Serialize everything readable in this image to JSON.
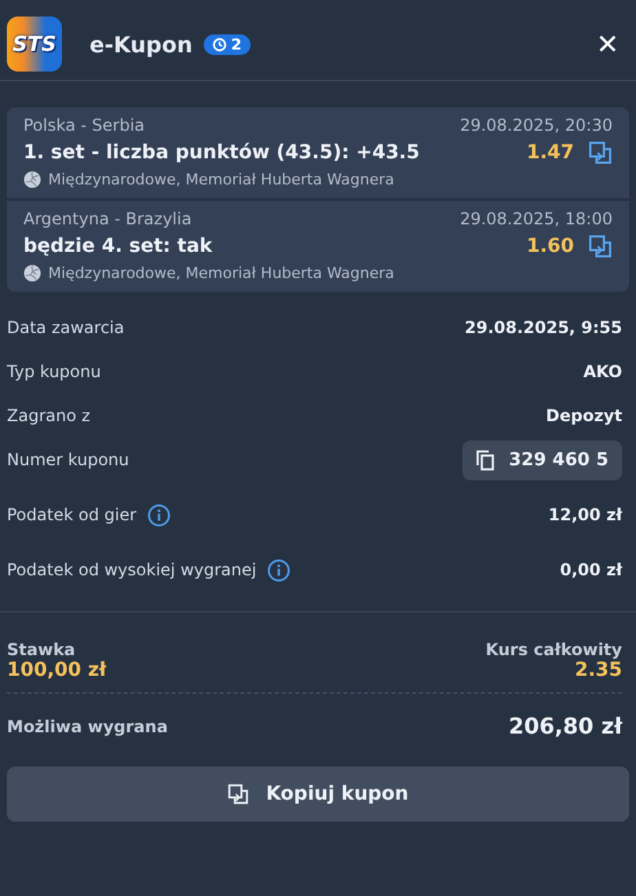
{
  "header": {
    "logo": "STS",
    "title": "e-Kupon",
    "badge": "2",
    "close": "✕"
  },
  "bets": [
    {
      "match": "Polska - Serbia",
      "datetime": "29.08.2025, 20:30",
      "selection": "1. set - liczba punktów (43.5): +43.5",
      "odds": "1.47",
      "league": "Międzynarodowe, Memoriał Huberta Wagnera"
    },
    {
      "match": "Argentyna - Brazylia",
      "datetime": "29.08.2025, 18:00",
      "selection": "będzie 4. set: tak",
      "odds": "1.60",
      "league": "Międzynarodowe, Memoriał Huberta Wagnera"
    }
  ],
  "details": [
    {
      "kind": "text",
      "label": "Data zawarcia",
      "value": "29.08.2025, 9:55",
      "info": false
    },
    {
      "kind": "text",
      "label": "Typ kuponu",
      "value": "AKO",
      "info": false
    },
    {
      "kind": "text",
      "label": "Zagrano z",
      "value": "Depozyt",
      "info": false
    },
    {
      "kind": "copy",
      "label": "Numer kuponu",
      "value": "329 460 5",
      "info": false
    },
    {
      "kind": "text",
      "label": "Podatek od gier",
      "value": "12,00 zł",
      "info": true
    },
    {
      "kind": "text",
      "label": "Podatek od wysokiej wygranej",
      "value": "0,00 zł",
      "info": true
    }
  ],
  "summary": {
    "stake_label": "Stawka",
    "stake": "100,00 zł",
    "total_odds_label": "Kurs całkowity",
    "total_odds": "2.35",
    "win_label": "Możliwa wygrana",
    "win": "206,80 zł"
  },
  "button": "Kopiuj kupon"
}
